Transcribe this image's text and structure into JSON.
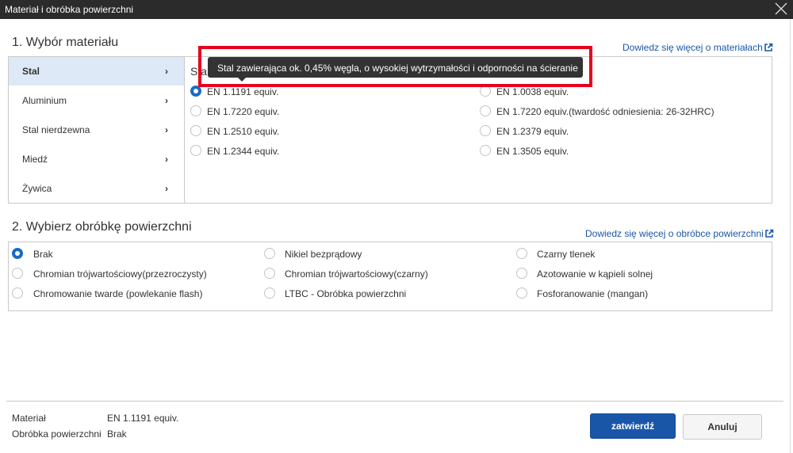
{
  "window": {
    "title": "Materiał i obróbka powierzchni"
  },
  "material_section": {
    "title": "1. Wybór materiału",
    "learn_more": "Dowiedz się więcej o materiałach",
    "categories": [
      {
        "label": "Stal",
        "chevron": "›",
        "selected": true
      },
      {
        "label": "Aluminium",
        "chevron": "›"
      },
      {
        "label": "Stal nierdzewna",
        "chevron": "›"
      },
      {
        "label": "Miedź",
        "chevron": "›"
      },
      {
        "label": "Żywica",
        "chevron": "›"
      }
    ],
    "panel_heading_partial": "Sta",
    "options": [
      {
        "label": "EN 1.1191 equiv.",
        "selected": true
      },
      {
        "label": "EN 1.0038 equiv."
      },
      {
        "label": "EN 1.7220 equiv."
      },
      {
        "label": "EN 1.7220 equiv.(twardość odniesienia: 26-32HRC)"
      },
      {
        "label": "EN 1.2510 equiv."
      },
      {
        "label": "EN 1.2379 equiv."
      },
      {
        "label": "EN 1.2344 equiv."
      },
      {
        "label": "EN 1.3505 equiv."
      }
    ],
    "tooltip": "Stal zawierająca ok. 0,45% węgla, o wysokiej wytrzymałości i odporności na ścieranie"
  },
  "surface_section": {
    "title": "2. Wybierz obróbkę powierzchni",
    "learn_more": "Dowiedz się więcej o obróbce powierzchni",
    "options": [
      {
        "label": "Brak",
        "selected": true
      },
      {
        "label": "Nikiel bezprądowy"
      },
      {
        "label": "Czarny tlenek"
      },
      {
        "label": "Chromian trójwartościowy(przezroczysty)"
      },
      {
        "label": "Chromian trójwartościowy(czarny)"
      },
      {
        "label": "Azotowanie w kąpieli solnej"
      },
      {
        "label": "Chromowanie twarde (powlekanie flash)"
      },
      {
        "label": "LTBC - Obróbka powierzchni"
      },
      {
        "label": "Fosforanowanie (mangan)"
      }
    ]
  },
  "summary": {
    "material_label": "Materiał",
    "material_value": "EN 1.1191 equiv.",
    "surface_label": "Obróbka powierzchni",
    "surface_value": "Brak"
  },
  "buttons": {
    "confirm": "zatwierdź",
    "cancel": "Anuluj"
  },
  "colors": {
    "accent": "#1a56a8",
    "highlight": "#e8001c",
    "selected_bg": "#dde9f6",
    "titlebar": "#2b2b2b"
  },
  "icons": {
    "close": "close-icon",
    "external": "external-link-icon",
    "chevron": "chevron-right-icon"
  }
}
